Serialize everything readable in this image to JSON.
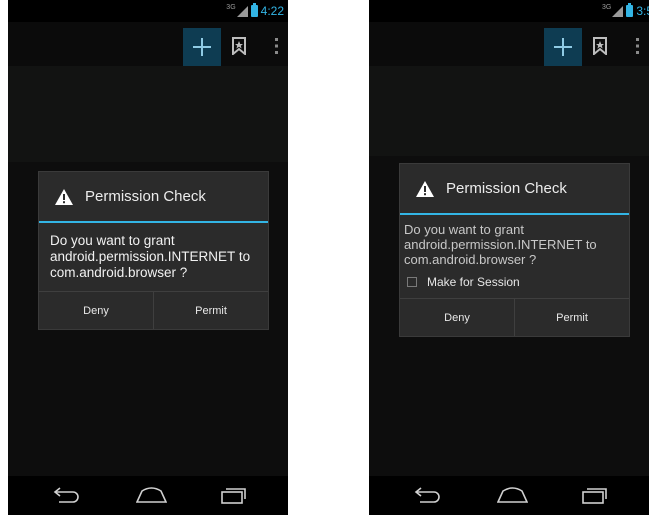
{
  "screens": [
    {
      "status": {
        "network": "3G",
        "time": "4:22"
      },
      "dialog": {
        "title": "Permission Check",
        "message": "Do you want to grant android.permission.INTERNET to com.android.browser ?",
        "deny_label": "Deny",
        "permit_label": "Permit"
      }
    },
    {
      "status": {
        "network": "3G",
        "time": "3:5"
      },
      "dialog": {
        "title": "Permission Check",
        "message": "Do you want to grant android.permission.INTERNET to com.android.browser ?",
        "session_label": "Make for Session",
        "session_checked": false,
        "deny_label": "Deny",
        "permit_label": "Permit"
      }
    }
  ],
  "icons": {
    "add": "plus-icon",
    "bookmark": "bookmark-icon",
    "overflow": "overflow-menu-icon",
    "warning": "warning-icon",
    "back": "back-icon",
    "home": "home-icon",
    "recent": "recent-apps-icon"
  },
  "colors": {
    "accent": "#33b5e5",
    "dialog_bg": "#2b2b2b",
    "screen_bg": "#080808",
    "action_highlight": "#0e3c52"
  }
}
